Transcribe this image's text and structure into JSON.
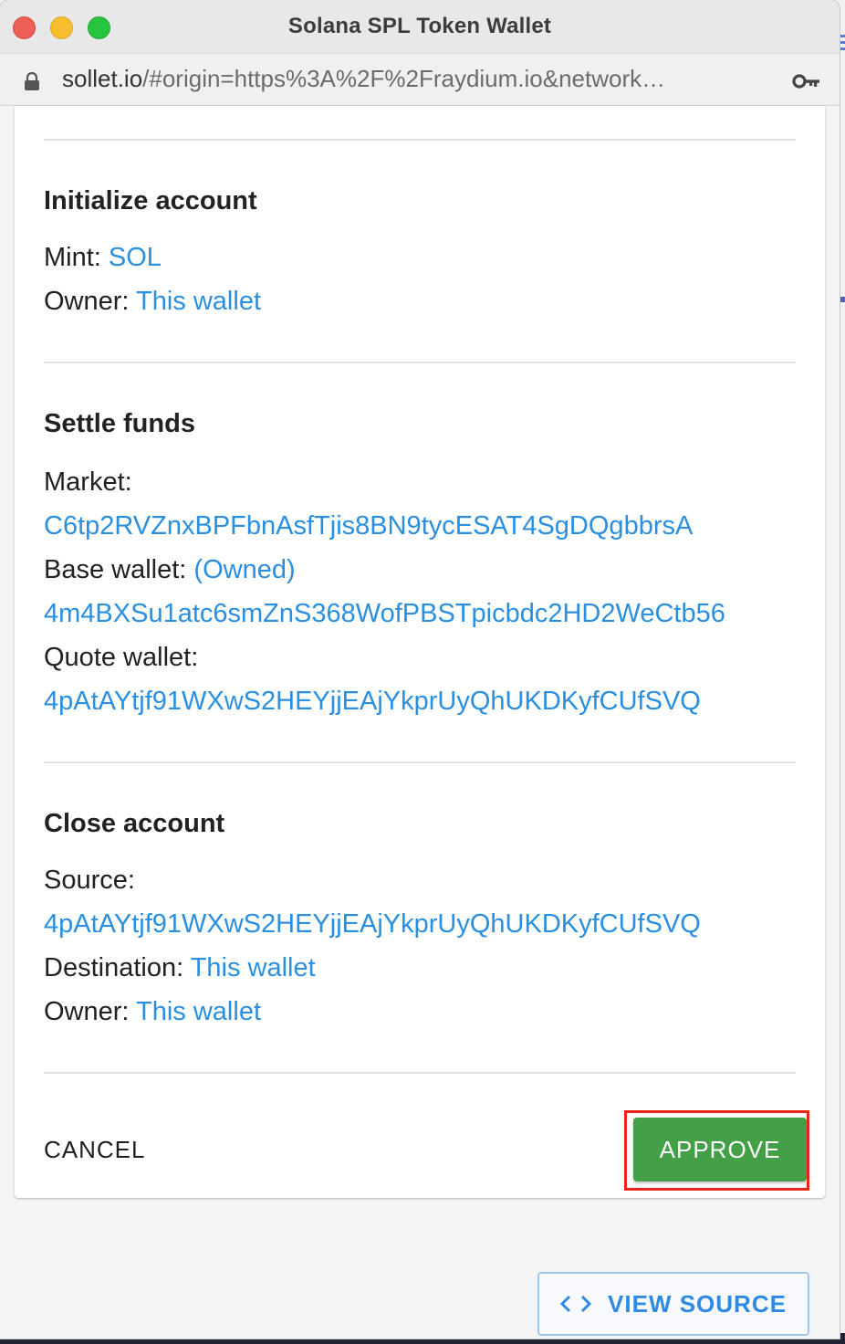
{
  "window": {
    "title": "Solana SPL Token Wallet"
  },
  "urlbar": {
    "host": "sollet.io",
    "path": "/#origin=https%3A%2F%2Fraydium.io&network…",
    "lock_icon": "lock-icon",
    "key_icon": "key-icon"
  },
  "sections": {
    "init": {
      "title": "Initialize account",
      "mint_label": "Mint: ",
      "mint_value": "SOL",
      "owner_label": "Owner: ",
      "owner_value": "This wallet"
    },
    "settle": {
      "title": "Settle funds",
      "market_label": "Market:",
      "market_value": "C6tp2RVZnxBPFbnAsfTjis8BN9tycESAT4SgDQgbbrsA",
      "base_label": "Base wallet: ",
      "base_tag": "(Owned)",
      "base_value": "4m4BXSu1atc6smZnS368WofPBSTpicbdc2HD2WeCtb56",
      "quote_label": "Quote wallet:",
      "quote_value": "4pAtAYtjf91WXwS2HEYjjEAjYkprUyQhUKDKyfCUfSVQ"
    },
    "close": {
      "title": "Close account",
      "source_label": "Source:",
      "source_value": "4pAtAYtjf91WXwS2HEYjjEAjYkprUyQhUKDKyfCUfSVQ",
      "dest_label": "Destination: ",
      "dest_value": "This wallet",
      "owner_label": "Owner: ",
      "owner_value": "This wallet"
    }
  },
  "actions": {
    "cancel_label": "CANCEL",
    "approve_label": "APPROVE",
    "view_source_label": "VIEW SOURCE",
    "view_source_icon": "code-icon"
  },
  "colors": {
    "link": "#2b8fe0",
    "approve_bg": "#43a047",
    "highlight": "#e8261b"
  }
}
